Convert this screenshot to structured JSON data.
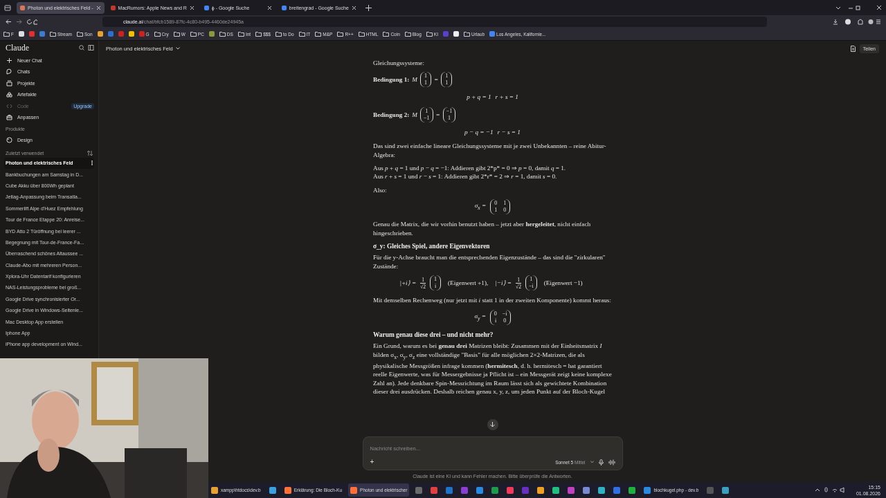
{
  "browser": {
    "tabs": [
      {
        "title": "Photon und elektrisches Feld -",
        "selected": true,
        "color": "#d97757"
      },
      {
        "title": "MacRumors: Apple News and R",
        "selected": false,
        "color": "#c0392b"
      },
      {
        "title": "ϕ - Google Suche",
        "selected": false,
        "color": "#4285f4"
      },
      {
        "title": "breitengrad - Google Suche",
        "selected": false,
        "color": "#4285f4"
      }
    ],
    "url": {
      "host": "claude.ai",
      "path": "/chat/bfcb1589-87fc-4c80-b495-4460de24945a"
    },
    "bookmarks": [
      {
        "kind": "folder",
        "label": "F"
      },
      {
        "kind": "site",
        "color": "#dddddd"
      },
      {
        "kind": "site",
        "color": "#e03030"
      },
      {
        "kind": "site",
        "color": "#3a7bd5"
      },
      {
        "kind": "folder",
        "label": "Stream"
      },
      {
        "kind": "folder",
        "label": "Son"
      },
      {
        "kind": "site",
        "color": "#e8a030"
      },
      {
        "kind": "site",
        "color": "#2f6fd0"
      },
      {
        "kind": "site",
        "color": "#d02020"
      },
      {
        "kind": "site",
        "color": "#f2c200"
      },
      {
        "kind": "site",
        "color": "#d02020",
        "label": "G"
      },
      {
        "kind": "folder",
        "label": "Cry"
      },
      {
        "kind": "folder",
        "label": "W"
      },
      {
        "kind": "folder",
        "label": "PC"
      },
      {
        "kind": "site",
        "color": "#8a9a3a"
      },
      {
        "kind": "folder",
        "label": "DS"
      },
      {
        "kind": "folder",
        "label": "Int"
      },
      {
        "kind": "folder",
        "label": "$$$"
      },
      {
        "kind": "folder",
        "label": "to Do"
      },
      {
        "kind": "folder",
        "label": "IT"
      },
      {
        "kind": "folder",
        "label": "M&P"
      },
      {
        "kind": "folder",
        "label": "R++"
      },
      {
        "kind": "folder",
        "label": "HTML"
      },
      {
        "kind": "folder",
        "label": "Coin"
      },
      {
        "kind": "folder",
        "label": "Blog"
      },
      {
        "kind": "folder",
        "label": "KI"
      },
      {
        "kind": "site",
        "color": "#5a3fd0"
      },
      {
        "kind": "site",
        "color": "#eeeeee"
      },
      {
        "kind": "folder",
        "label": "Urlaub"
      },
      {
        "kind": "site",
        "color": "#4285f4",
        "label": "Los Angeles, Kalifornie..."
      }
    ]
  },
  "sidebar": {
    "brand": "Claude",
    "nav": [
      {
        "kind": "plus",
        "label": "Neuer Chat",
        "disabled": false
      },
      {
        "kind": "chats",
        "label": "Chats",
        "disabled": false
      },
      {
        "kind": "projects",
        "label": "Projekte",
        "disabled": false
      },
      {
        "kind": "artifacts",
        "label": "Artefakte",
        "disabled": false
      },
      {
        "kind": "code",
        "label": "Code",
        "disabled": true,
        "badge": "Upgrade"
      },
      {
        "kind": "customize",
        "label": "Anpassen",
        "disabled": false
      }
    ],
    "products_heading": "Produkte",
    "products": [
      {
        "label": "Design"
      }
    ],
    "recent_heading": "Zuletzt verwendet",
    "recents": [
      {
        "title": "Photon und elektrisches Feld",
        "selected": true
      },
      {
        "title": "Bankbuchungen am Samstag in D...",
        "selected": false
      },
      {
        "title": "Cube Akku über 800Wh geplant",
        "selected": false
      },
      {
        "title": "Jetlag-Anpassung beim Transatla...",
        "selected": false
      },
      {
        "title": "Sommerlift Alpe d'Huez Empfehlung",
        "selected": false
      },
      {
        "title": "Tour de France Etappe 20: Anreise...",
        "selected": false
      },
      {
        "title": "BYD Atto 2 Türöffnung bei leerer ...",
        "selected": false
      },
      {
        "title": "Begegnung mit Tour-de-France-Fa...",
        "selected": false
      },
      {
        "title": "Überraschend schönes Altaussee ...",
        "selected": false
      },
      {
        "title": "Claude-Abo mit mehreren Person...",
        "selected": false
      },
      {
        "title": "Xplora-Uhr Datentarif konfigurieren",
        "selected": false
      },
      {
        "title": "NAS-Leistungsprobleme bei groß...",
        "selected": false
      },
      {
        "title": "Google Drive synchronisierter Or...",
        "selected": false
      },
      {
        "title": "Google Drive in Windows-Seitenle...",
        "selected": false
      },
      {
        "title": "Mac Desktop App erstellen",
        "selected": false
      },
      {
        "title": "Iphone App",
        "selected": false
      },
      {
        "title": "iPhone app development on Wind...",
        "selected": false
      }
    ]
  },
  "chat": {
    "title": "Photon und elektrisches Feld",
    "share": "Teilen",
    "blocks": [
      {
        "kind": "para",
        "text": "Gleichungssysteme:"
      },
      {
        "kind": "line",
        "parts": [
          {
            "kind": "bold",
            "text": "Bedingung 1:"
          },
          {
            "kind": "math",
            "text": "M"
          },
          {
            "kind": "matrix",
            "rows": [
              [
                "1"
              ],
              [
                "1"
              ]
            ]
          },
          {
            "kind": "math",
            "text": "="
          },
          {
            "kind": "matrix",
            "rows": [
              [
                "1"
              ],
              [
                "1"
              ]
            ]
          }
        ]
      },
      {
        "kind": "display",
        "parts": [
          {
            "kind": "math",
            "text": "p + q = 1"
          },
          {
            "kind": "math",
            "text": "r + s = 1"
          }
        ]
      },
      {
        "kind": "line",
        "parts": [
          {
            "kind": "bold",
            "text": "Bedingung 2:"
          },
          {
            "kind": "math",
            "text": "M"
          },
          {
            "kind": "matrix",
            "rows": [
              [
                "1"
              ],
              [
                "−1"
              ]
            ]
          },
          {
            "kind": "math",
            "text": "="
          },
          {
            "kind": "matrix",
            "rows": [
              [
                "−1"
              ],
              [
                "1"
              ]
            ]
          }
        ]
      },
      {
        "kind": "display",
        "parts": [
          {
            "kind": "math",
            "text": "p − q = −1"
          },
          {
            "kind": "math",
            "text": "r − s = 1"
          }
        ]
      },
      {
        "kind": "para",
        "text": "Das sind zwei einfache lineare Gleichungssysteme mit je zwei Unbekannten – reine Abitur-Algebra:"
      },
      {
        "kind": "para",
        "text": "Aus *p* + *q* = 1 und *p* − *q* = −1: Addieren gibt 2*p* = 0 ⇒ *p* = 0, damit *q* = 1."
      },
      {
        "kind": "tight",
        "text": "Aus *r* + *s* = 1 und *r* − *s* = 1: Addieren gibt 2*r* = 2 ⇒ *r* = 1, damit *s* = 0."
      },
      {
        "kind": "para",
        "text": "Also:"
      },
      {
        "kind": "display",
        "parts": [
          {
            "kind": "math",
            "text": "σ$_{x}$ ="
          },
          {
            "kind": "matrix",
            "rows": [
              [
                "0",
                "1"
              ],
              [
                "1",
                "0"
              ]
            ]
          }
        ]
      },
      {
        "kind": "para",
        "text": "Genau die Matrix, die wir vorhin benutzt haben – jetzt aber **hergeleitet**, nicht einfach hingeschrieben."
      },
      {
        "kind": "heading",
        "text": "σ_y: Gleiches Spiel, andere Eigenvektoren"
      },
      {
        "kind": "para",
        "text": "Für die y-Achse braucht man die entsprechenden Eigenzustände – das sind die \"zirkularen\" Zustände:"
      },
      {
        "kind": "display",
        "parts": [
          {
            "kind": "math",
            "text": "|+i⟩ ="
          },
          {
            "kind": "frac",
            "num": "1",
            "den": "√2"
          },
          {
            "kind": "matrix",
            "rows": [
              [
                "1"
              ],
              [
                "i"
              ]
            ]
          },
          {
            "kind": "plain",
            "text": "(Eigenwert +1),"
          },
          {
            "kind": "math",
            "text": "|−i⟩ ="
          },
          {
            "kind": "frac",
            "num": "1",
            "den": "√2"
          },
          {
            "kind": "matrix",
            "rows": [
              [
                "1"
              ],
              [
                "−i"
              ]
            ]
          },
          {
            "kind": "plain",
            "text": "(Eigenwert −1)"
          }
        ]
      },
      {
        "kind": "para",
        "text": "Mit demselben Rechenweg (nur jetzt mit *i* statt 1 in der zweiten Komponente) kommt heraus:"
      },
      {
        "kind": "display",
        "parts": [
          {
            "kind": "math",
            "text": "σ$_{y}$ ="
          },
          {
            "kind": "matrix",
            "rows": [
              [
                "0",
                "−i"
              ],
              [
                "i",
                "0"
              ]
            ]
          }
        ]
      },
      {
        "kind": "heading",
        "text": "Warum genau diese drei – und nicht mehr?"
      },
      {
        "kind": "para",
        "text": "Ein Grund, warum es bei **genau drei** Matrizen bleibt: Zusammen mit der Einheitsmatrix *I* bilden σ$_{x}$, σ$_{y}$, σ$_{z}$ eine vollständige \"Basis\" für alle möglichen 2×2-Matrizen, die als physikalische Messgrößen infrage kommen (**hermitesch**, d. h. hermitesch = hat garantiert reelle Eigenwerte, was für Messergebnisse ja Pflicht ist – ein Messgerät zeigt keine komplexe Zahl an). Jede denkbare Spin-Messrichtung im Raum lässt sich als gewichtete Kombination dieser drei ausdrücken. Deshalb reichen genau x, y, z, um jeden Punkt auf der Bloch-Kugel"
      }
    ],
    "composer": {
      "placeholder": "Nachricht schreiben...",
      "add": "+",
      "model": "Sonnet 5",
      "effort": "Mittel"
    },
    "disclaimer": "Claude ist eine KI und kann Fehler machen. Bitte überprüfe die Antworten."
  },
  "taskbar": {
    "items": [
      {
        "kind": "window",
        "label": "xampp\\htdocs\\dev.b",
        "color": "#e8a030",
        "selected": false
      },
      {
        "kind": "app",
        "color": "#3aa0e0",
        "selected": false
      },
      {
        "kind": "window",
        "label": "Erklärung: Die Bloch-Ku",
        "color": "#ff7139",
        "selected": false
      },
      {
        "kind": "window",
        "label": "Photon und elektrischer",
        "color": "#ff7139",
        "selected": true
      },
      {
        "kind": "app",
        "color": "#6a6a6a",
        "selected": false
      },
      {
        "kind": "app",
        "color": "#e04040",
        "selected": false
      },
      {
        "kind": "app",
        "color": "#1e73c8",
        "selected": false
      },
      {
        "kind": "app",
        "color": "#8a3fd0",
        "selected": false
      },
      {
        "kind": "app",
        "color": "#2a8ae0",
        "selected": false
      },
      {
        "kind": "app",
        "color": "#1f9a4a",
        "selected": false
      },
      {
        "kind": "app",
        "color": "#f03a5a",
        "selected": false
      },
      {
        "kind": "app",
        "color": "#6a2fc0",
        "selected": false
      },
      {
        "kind": "app",
        "color": "#f0a020",
        "selected": false
      },
      {
        "kind": "app",
        "color": "#20c080",
        "selected": false
      },
      {
        "kind": "app",
        "color": "#c040c0",
        "selected": false
      },
      {
        "kind": "app",
        "color": "#7a8ad0",
        "selected": false
      },
      {
        "kind": "app",
        "color": "#30b0c0",
        "selected": false
      },
      {
        "kind": "app",
        "color": "#3070e0",
        "selected": false
      },
      {
        "kind": "app",
        "color": "#20b040",
        "selected": false
      },
      {
        "kind": "window",
        "label": "blochkugel.php - dev.b",
        "color": "#2a8ae0",
        "selected": false
      },
      {
        "kind": "app",
        "color": "#555555",
        "selected": false
      },
      {
        "kind": "app",
        "color": "#3aa0c0",
        "selected": false
      }
    ],
    "time": "15:15",
    "date": "01.08.2026"
  }
}
